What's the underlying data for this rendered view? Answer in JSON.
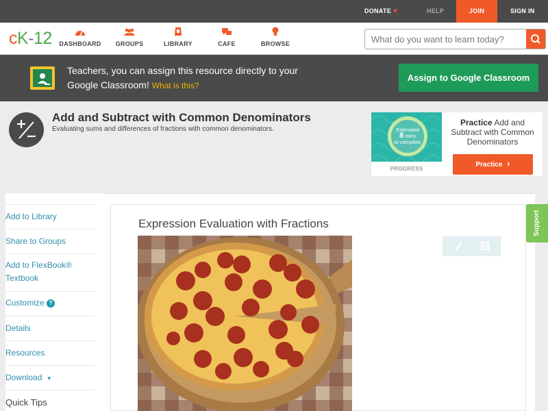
{
  "topbar": {
    "donate": "DONATE",
    "help": "HELP",
    "join": "JOIN",
    "sign_in": "SIGN IN"
  },
  "header": {
    "logo": {
      "c": "c",
      "k": "K",
      "dash": "-",
      "num": "12"
    },
    "nav": [
      {
        "label": "DASHBOARD",
        "icon": "dashboard-icon"
      },
      {
        "label": "GROUPS",
        "icon": "groups-icon"
      },
      {
        "label": "LIBRARY",
        "icon": "library-icon"
      },
      {
        "label": "CAFE",
        "icon": "cafe-icon"
      },
      {
        "label": "BROWSE",
        "icon": "browse-icon"
      }
    ],
    "search_placeholder": "What do you want to learn today?"
  },
  "banner": {
    "text": "Teachers, you can assign this resource directly to your Google Classroom!",
    "what_link": "What is this?",
    "assign_button": "Assign to Google Classroom"
  },
  "concept": {
    "title": "Add and Subtract with Common Denominators",
    "subtitle": "Evaluating sums and differences of fractions with common denominators."
  },
  "practice": {
    "ring_line1": "Estimated",
    "ring_line2": "8",
    "ring_line2b": "mins",
    "ring_line3": "to complete",
    "progress_label": "PROGRESS",
    "title_bold": "Practice",
    "title_rest": "Add and Subtract with Common Denominators",
    "button": "Practice"
  },
  "sidebar": {
    "items": [
      {
        "label": "Add to Library"
      },
      {
        "label": "Share to Groups"
      },
      {
        "label": "Add to FlexBook® Textbook"
      },
      {
        "label": "Customize"
      },
      {
        "label": "Details"
      },
      {
        "label": "Resources"
      },
      {
        "label": "Download"
      }
    ],
    "quick_tips": "Quick Tips"
  },
  "main": {
    "lesson_title": "Expression Evaluation with Fractions"
  },
  "support_tab": "Support",
  "colors": {
    "brand_orange": "#f05a28",
    "brand_green": "#48a84a",
    "classroom_green": "#1f9b59",
    "link_blue": "#2f8fad",
    "support_green": "#7dc557"
  }
}
